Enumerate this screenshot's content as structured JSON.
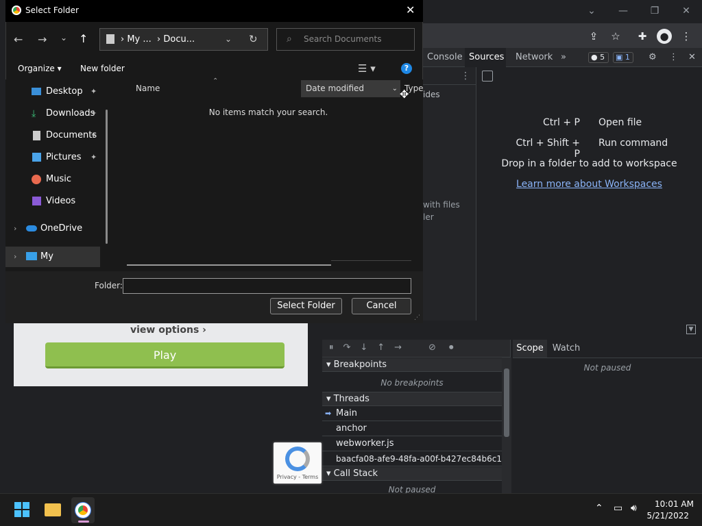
{
  "chrome": {
    "window_controls": {
      "min": "—",
      "max": "❐",
      "close": "✕",
      "dropdown": "⌄"
    }
  },
  "devtools": {
    "tabs": [
      "Console",
      "Sources",
      "Network"
    ],
    "more_tabs": "»",
    "errors_count": "5",
    "messages_count": "1",
    "left_panel_frag1": "ides",
    "left_panel_frag2": "with files",
    "left_panel_frag3": "ler",
    "editor": {
      "shortcuts": [
        {
          "key": "Ctrl + P",
          "label": "Open file"
        },
        {
          "key": "Ctrl + Shift + P",
          "label": "Run command"
        }
      ],
      "drop_text": "Drop in a folder to add to workspace",
      "learn_link": "Learn more about Workspaces"
    },
    "debugger": {
      "right_tabs": [
        "Scope",
        "Watch"
      ],
      "scope_status": "Not paused",
      "breakpoints_header": "Breakpoints",
      "no_breakpoints": "No breakpoints",
      "threads_header": "Threads",
      "threads": [
        "Main",
        "anchor",
        "webworker.js",
        "baacfa08-afe9-48fa-a00f-b427ec84b6c1"
      ],
      "callstack_header": "Call Stack",
      "callstack_status": "Not paused"
    }
  },
  "page": {
    "view_options": "view options",
    "play": "Play",
    "recaptcha_footer": "Privacy - Terms"
  },
  "dialog": {
    "title": "Select Folder",
    "breadcrumb": [
      "My ...",
      "Docu..."
    ],
    "search_placeholder": "Search Documents",
    "organize": "Organize",
    "new_folder": "New folder",
    "nav_items": [
      {
        "label": "Desktop",
        "icon": "desktop-icon",
        "pinned": true
      },
      {
        "label": "Downloads",
        "icon": "downloads-icon",
        "pinned": true
      },
      {
        "label": "Documents",
        "icon": "documents-icon",
        "pinned": true
      },
      {
        "label": "Pictures",
        "icon": "pictures-icon",
        "pinned": true
      },
      {
        "label": "Music",
        "icon": "music-icon",
        "pinned": false
      },
      {
        "label": "Videos",
        "icon": "videos-icon",
        "pinned": false
      },
      {
        "label": "OneDrive",
        "icon": "onedrive-icon",
        "pinned": false
      },
      {
        "label": "My Computer",
        "icon": "computer-icon",
        "pinned": false
      }
    ],
    "columns": [
      "Name",
      "Date modified",
      "Type"
    ],
    "empty_message": "No items match your search.",
    "folder_label": "Folder:",
    "folder_value": "",
    "select_button": "Select Folder",
    "cancel_button": "Cancel"
  },
  "taskbar": {
    "time": "10:01 AM",
    "date": "5/21/2022"
  },
  "colors": {
    "accent_blue": "#8ab4f8",
    "play_green": "#8fbf4f",
    "dialog_bg": "#191919"
  }
}
